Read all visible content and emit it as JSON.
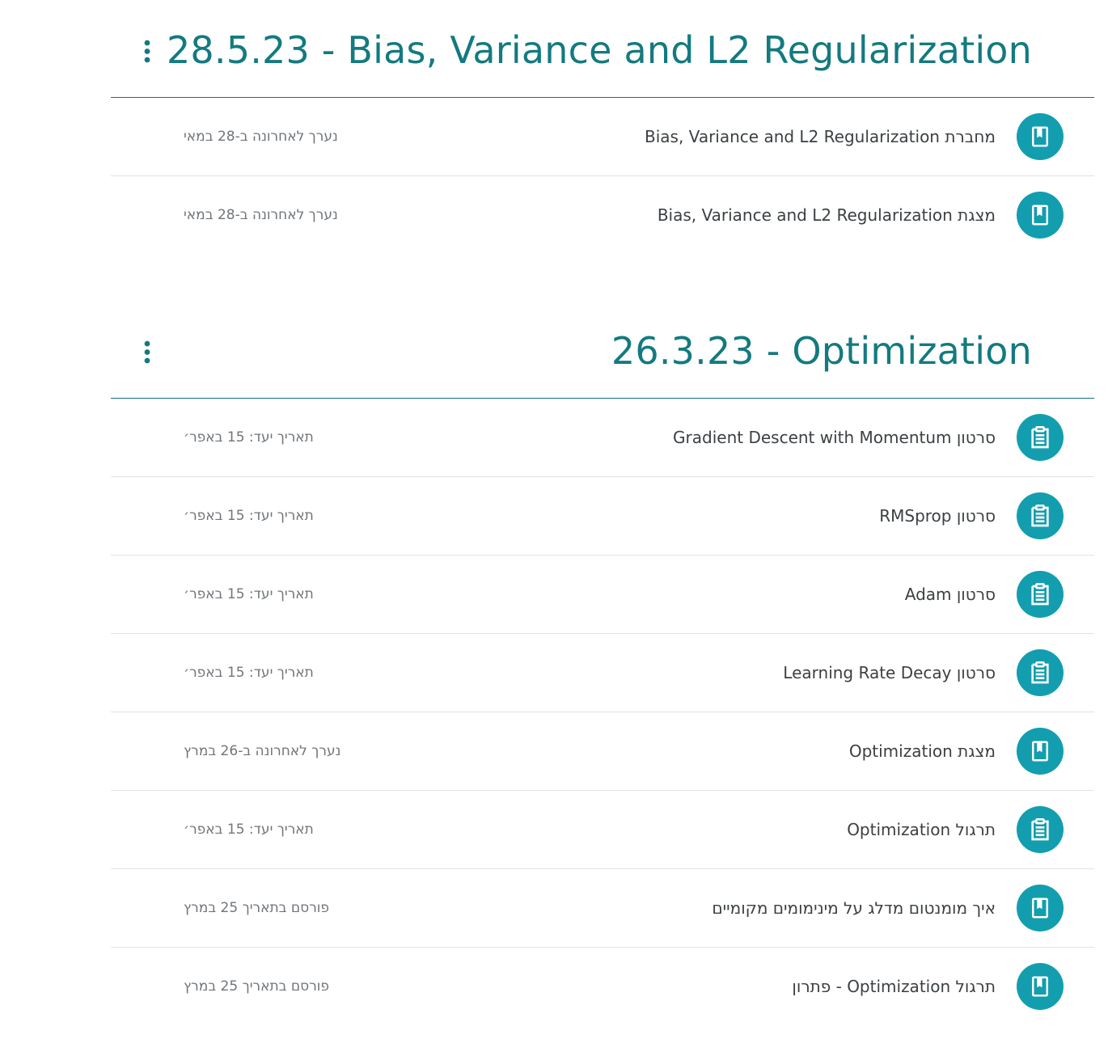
{
  "sections": [
    {
      "title": "28.5.23 - Bias, Variance and L2 Regularization",
      "items": [
        {
          "title": "מחברת Bias, Variance and L2 Regularization",
          "meta": "נערך לאחרונה ב-28 במאי",
          "icon": "material-icon"
        },
        {
          "title": "מצגת Bias, Variance and L2 Regularization",
          "meta": "נערך לאחרונה ב-28 במאי",
          "icon": "material-icon"
        }
      ]
    },
    {
      "title": "26.3.23 - Optimization",
      "items": [
        {
          "title": "סרטון Gradient Descent with Momentum",
          "meta": "תאריך יעד: 15 באפר׳",
          "icon": "assignment-icon"
        },
        {
          "title": "סרטון RMSprop",
          "meta": "תאריך יעד: 15 באפר׳",
          "icon": "assignment-icon"
        },
        {
          "title": "סרטון Adam",
          "meta": "תאריך יעד: 15 באפר׳",
          "icon": "assignment-icon"
        },
        {
          "title": "סרטון Learning Rate Decay",
          "meta": "תאריך יעד: 15 באפר׳",
          "icon": "assignment-icon"
        },
        {
          "title": "מצגת Optimization",
          "meta": "נערך לאחרונה ב-26 במרץ",
          "icon": "material-icon"
        },
        {
          "title": "תרגול Optimization",
          "meta": "תאריך יעד: 15 באפר׳",
          "icon": "assignment-icon"
        },
        {
          "title": "איך מומנטום מדלג על מינימומים מקומיים",
          "meta": "פורסם בתאריך 25 במרץ",
          "icon": "material-icon"
        },
        {
          "title": "תרגול Optimization - פתרון",
          "meta": "פורסם בתאריך 25 במרץ",
          "icon": "material-icon"
        }
      ]
    }
  ],
  "colors": {
    "accent": "#137a80",
    "icon_bg": "#129eaf",
    "title_text": "#3c4043",
    "meta_text": "#70757a"
  }
}
